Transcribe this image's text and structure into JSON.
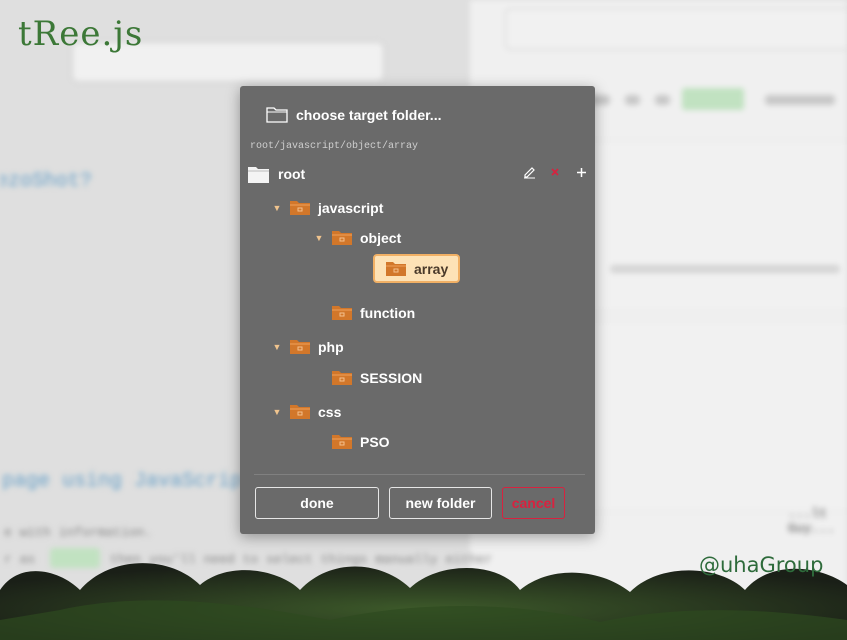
{
  "logo": "tRee.js",
  "brand": "@uhaGroup",
  "background": {
    "link1": "ezoShot?",
    "link2": "page using JavaScript",
    "mono1": "e with information.",
    "mono2": "r as",
    "mono3": "then you'll need to select things manually either",
    "dots": "...",
    "tail": "...lt Guy..."
  },
  "modal": {
    "title": "choose target folder...",
    "path": "root/javascript/object/array",
    "root_label": "root",
    "tree": {
      "javascript": "javascript",
      "object": "object",
      "array": "array",
      "function": "function",
      "php": "php",
      "session": "SESSION",
      "css": "css",
      "pso": "PSO"
    },
    "buttons": {
      "done": "done",
      "new_folder": "new folder",
      "cancel": "cancel"
    }
  },
  "colors": {
    "folder": "#d2772a",
    "selected_bg": "#fde2b6",
    "cancel": "#d8223f",
    "modal_bg": "#6a6a6a"
  }
}
